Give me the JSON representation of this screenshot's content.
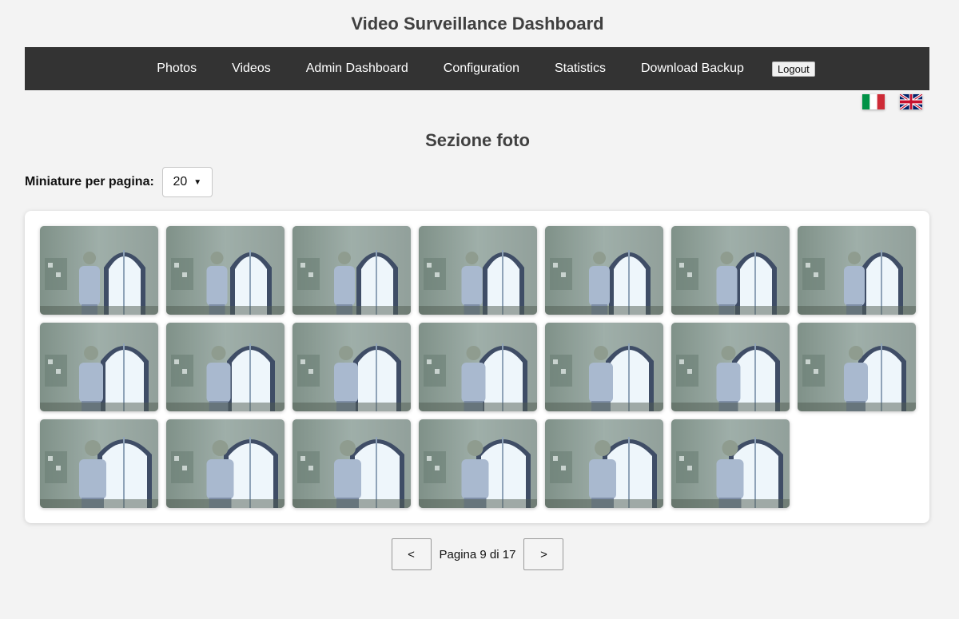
{
  "header": {
    "title": "Video Surveillance Dashboard"
  },
  "nav": {
    "items": [
      {
        "label": "Photos"
      },
      {
        "label": "Videos"
      },
      {
        "label": "Admin Dashboard"
      },
      {
        "label": "Configuration"
      },
      {
        "label": "Statistics"
      },
      {
        "label": "Download Backup"
      }
    ],
    "logout_label": "Logout"
  },
  "languages": [
    {
      "icon": "italian-flag-icon",
      "colors": [
        "#009246",
        "#ffffff",
        "#ce2b37"
      ]
    },
    {
      "icon": "uk-flag-icon",
      "colors": [
        "#012169",
        "#ffffff",
        "#c8102e"
      ]
    }
  ],
  "section": {
    "title": "Sezione foto"
  },
  "per_page": {
    "label": "Miniature per pagina:",
    "selected": "20"
  },
  "gallery": {
    "thumbnail_icon": "surveillance-photo-thumbnail",
    "thumbnail_count": 20
  },
  "pagination": {
    "prev_label": "<",
    "next_label": ">",
    "info": "Pagina 9 di 17"
  },
  "colors": {
    "navbar": "#333333",
    "page_background": "#f3f3f3"
  }
}
